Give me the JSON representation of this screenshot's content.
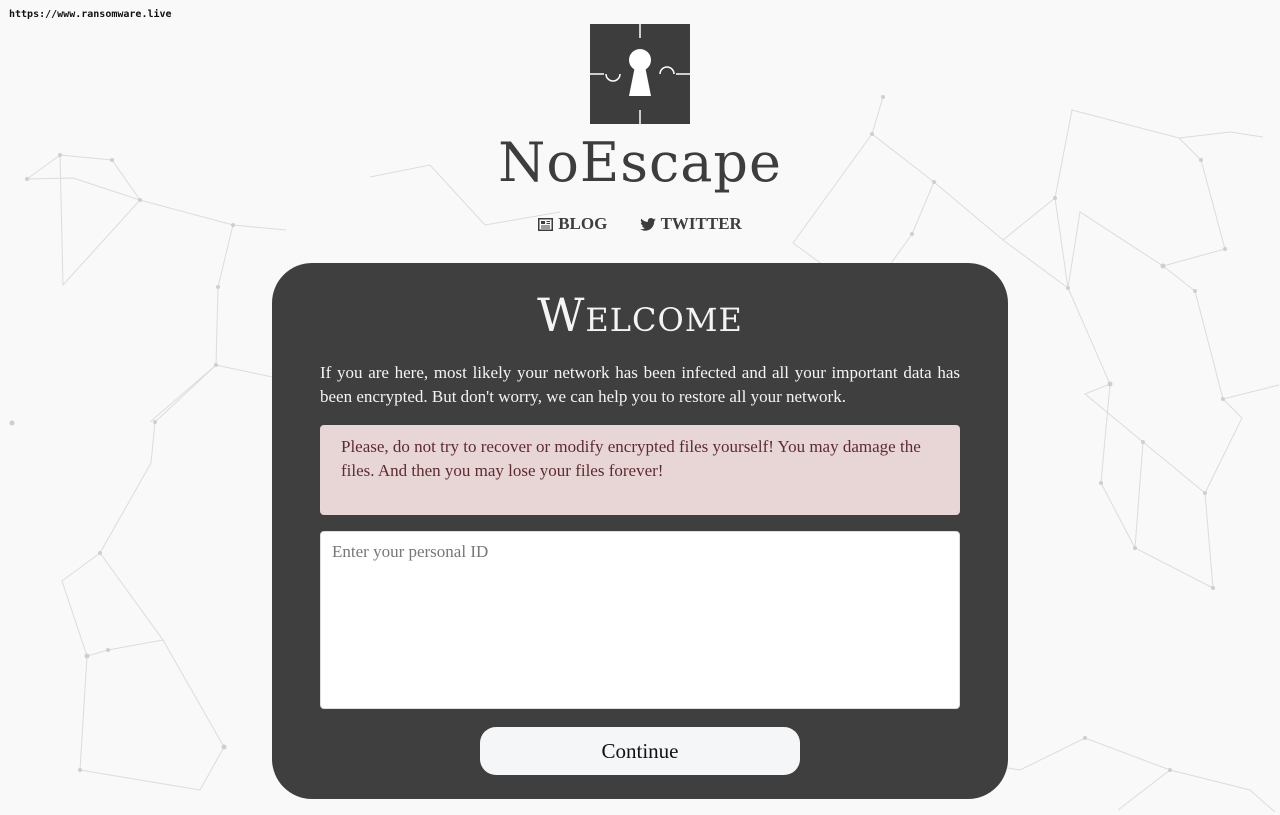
{
  "browser": {
    "url": "https://www.ransomware.live"
  },
  "header": {
    "logo_icon": "keyhole-puzzle-icon",
    "brand": "NoEscape",
    "nav": [
      {
        "label": "BLOG",
        "icon": "newspaper-icon"
      },
      {
        "label": "TWITTER",
        "icon": "twitter-bird-icon"
      }
    ]
  },
  "card": {
    "title": "Welcome",
    "intro": "If you are here, most likely your network has been infected and all your important data has been encrypted. But don't worry, we can help you to restore all your network.",
    "warning": "Please, do not try to recover or modify encrypted files yourself! You may damage the files. And then you may lose your files forever!",
    "id_input": {
      "value": "",
      "placeholder": "Enter your personal ID"
    },
    "continue_label": "Continue"
  },
  "colors": {
    "page_bg": "#f9f9f9",
    "card_bg": "#3f3f3f",
    "warning_bg": "#e8d6d7",
    "warning_text": "#5c2b2f",
    "brand_text": "#3d3d3d"
  }
}
